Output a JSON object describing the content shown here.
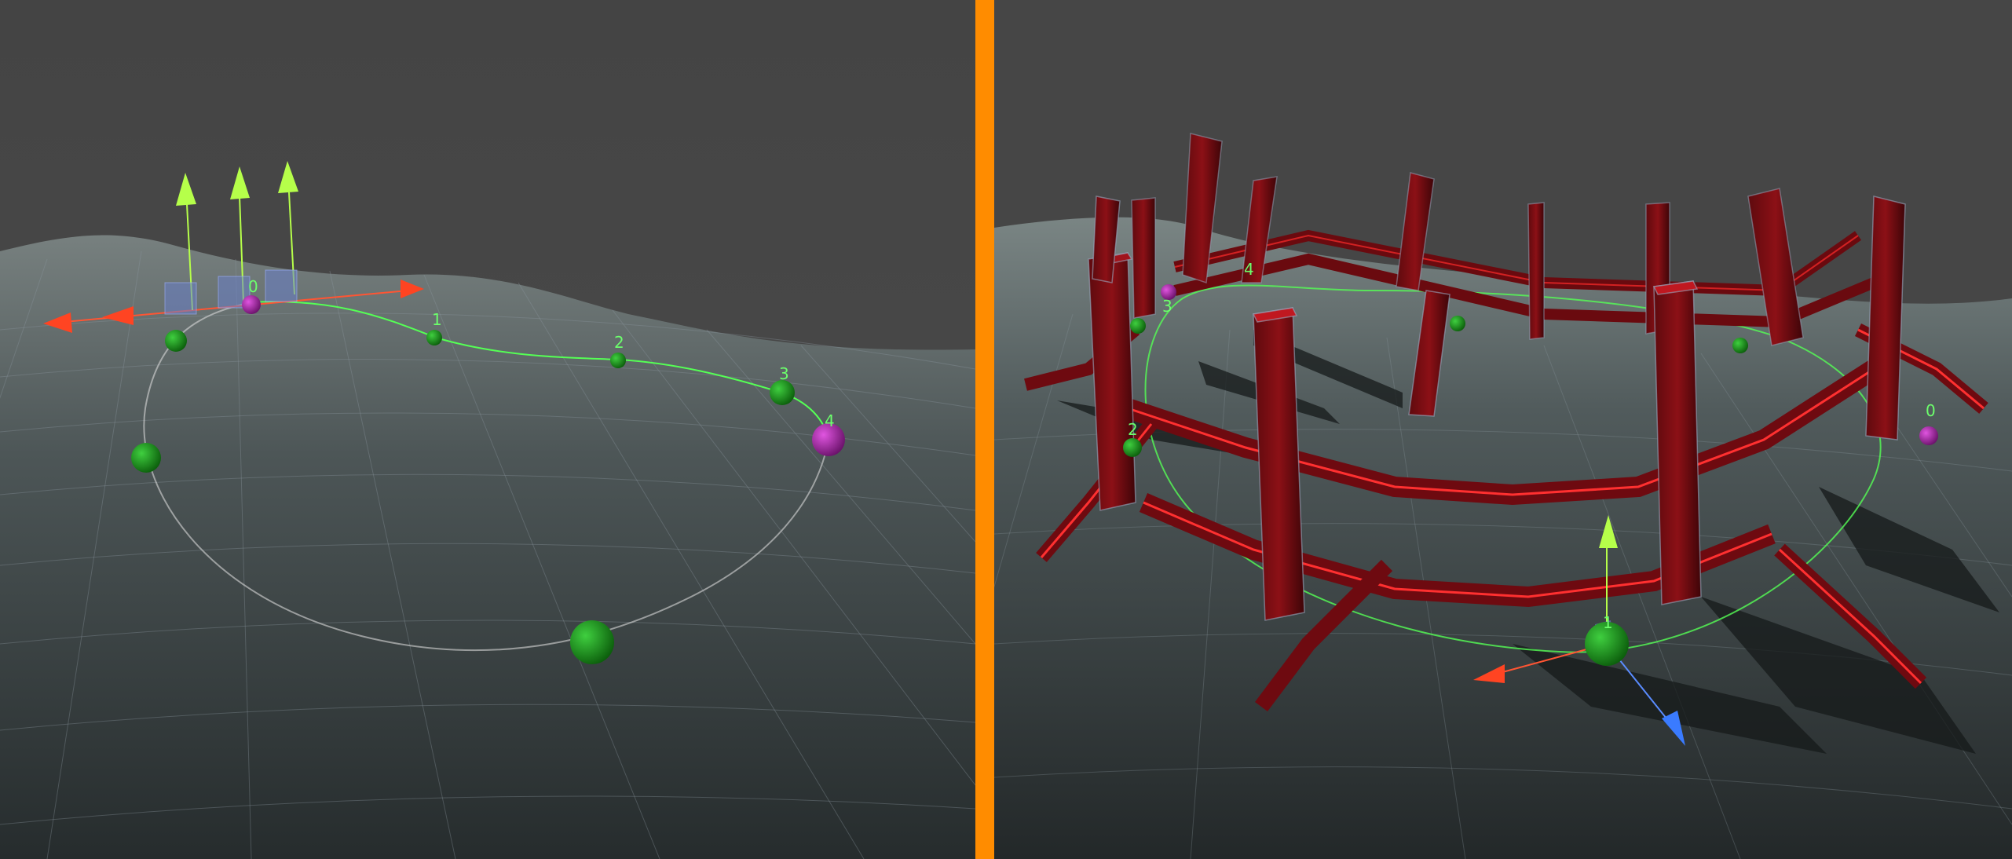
{
  "colors": {
    "divider": "#ff8c00",
    "sky": "#464646",
    "terrain_far": "#6b7575",
    "terrain_near": "#1f2526",
    "grid": "#8a9aa4",
    "spline": "#55ff55",
    "node_green": "#1e8f1e",
    "node_magenta": "#b02bb0",
    "fence_red": "#7a0a10",
    "fence_highlight": "#ff2b2b",
    "gizmo_x": "#ff4422",
    "gizmo_y": "#b6ff4a",
    "gizmo_z": "#3a7bff",
    "label": "#6cff6c"
  },
  "left_view": {
    "description_icon": "scene-view-spline-icon",
    "node_labels": [
      "0",
      "1",
      "2",
      "3",
      "4"
    ]
  },
  "right_view": {
    "description_icon": "scene-view-fence-icon",
    "node_labels": [
      "0",
      "1",
      "2",
      "3",
      "4"
    ]
  }
}
